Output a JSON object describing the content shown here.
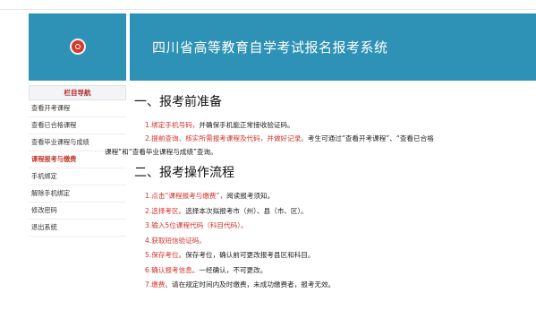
{
  "header": {
    "title": "四川省高等教育自学考试报名报考系统"
  },
  "sidebar": {
    "heading": "栏目导航",
    "items": [
      {
        "label": "查看开考课程"
      },
      {
        "label": "查看已合格课程"
      },
      {
        "label": "查看毕业课程与成绩"
      },
      {
        "label": "课程报考与缴费"
      },
      {
        "label": "手机绑定"
      },
      {
        "label": "解除手机绑定"
      },
      {
        "label": "修改密码"
      },
      {
        "label": "退出系统"
      }
    ]
  },
  "section1": {
    "title": "一、报考前准备",
    "p1_red": "1.绑定手机号码，",
    "p1_black": "并确保手机能正常接收验证码。",
    "p2_red": "2.提前查询、核实所需报考课程及代码，并做好记录。",
    "p2_black": "考生可通过“查看开考课程”、“查看已合格",
    "p2_wrap": "课程”和“查看毕业课程与成绩”查询。"
  },
  "section2": {
    "title": "二、报考操作流程",
    "steps": [
      {
        "red": "1.点击“课程报考与缴费”，",
        "black": "阅读报考须知。"
      },
      {
        "red": "2.选择考区。",
        "black": "选择本次拟报考市（州）、县（市、区）。"
      },
      {
        "red": "3.输入5位课程代码（科目代码）。",
        "black": ""
      },
      {
        "red": "4.获取短信验证码。",
        "black": ""
      },
      {
        "red": "5.保存考位。",
        "black": "保存考位，确认前可更改报考县区和科目。"
      },
      {
        "red": "6.确认报考信息。",
        "black": "一经确认，不可更改。"
      },
      {
        "red": "7.缴费。",
        "black": "请在规定时间内及时缴费，未成功缴费者，报考无效。"
      }
    ]
  },
  "colors": {
    "header_bg": "#2e92b6",
    "accent_red": "#d2332b"
  }
}
